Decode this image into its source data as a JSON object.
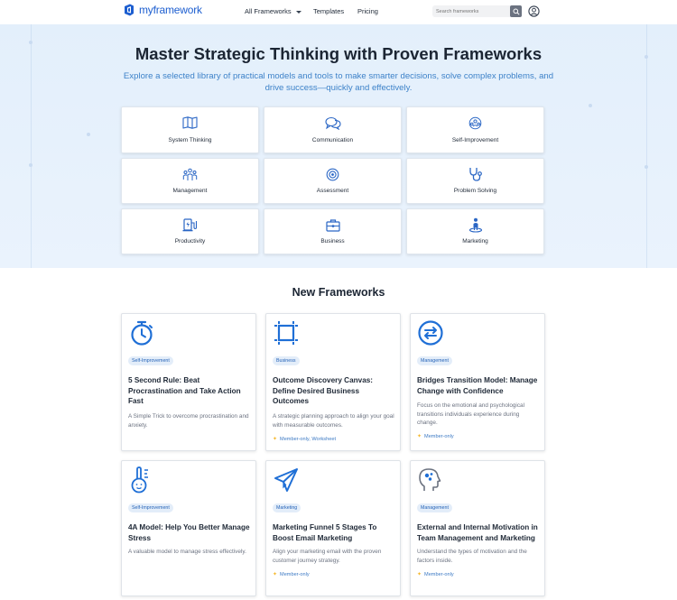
{
  "nav": {
    "logo_text": "myframework",
    "links": [
      {
        "label": "All Frameworks",
        "has_dropdown": true
      },
      {
        "label": "Templates"
      },
      {
        "label": "Pricing"
      }
    ],
    "search_placeholder": "Search frameworks"
  },
  "hero": {
    "title": "Master Strategic Thinking with Proven Frameworks",
    "subtitle": "Explore a selected library of practical models and tools to make smarter decisions, solve complex problems, and drive success—quickly and effectively."
  },
  "categories": [
    {
      "label": "System Thinking",
      "icon": "map-icon"
    },
    {
      "label": "Communication",
      "icon": "chat-bubbles-icon"
    },
    {
      "label": "Self-Improvement",
      "icon": "people-circle-icon"
    },
    {
      "label": "Management",
      "icon": "team-icon"
    },
    {
      "label": "Assessment",
      "icon": "target-icon"
    },
    {
      "label": "Problem Solving",
      "icon": "stethoscope-icon"
    },
    {
      "label": "Productivity",
      "icon": "ev-charger-icon"
    },
    {
      "label": "Business",
      "icon": "briefcase-icon"
    },
    {
      "label": "Marketing",
      "icon": "person-pin-icon"
    }
  ],
  "new_frameworks": {
    "title": "New Frameworks",
    "cards": [
      {
        "badge": "Self-Improvement",
        "title": "5 Second Rule: Beat Procrastination and Take Action Fast",
        "desc": "A Simple Trick to overcome procrastination and anxiety.",
        "meta": "",
        "icon": "stopwatch-icon"
      },
      {
        "badge": "Business",
        "title": "Outcome Discovery Canvas: Define Desired Business Outcomes",
        "desc": "A strategic planning approach to align your goal with measurable outcomes.",
        "meta": "Member-only, Worksheet",
        "icon": "canvas-frame-icon"
      },
      {
        "badge": "Management",
        "title": "Bridges Transition Model: Manage Change with Confidence",
        "desc": "Focus on the emotional and psychological transitions individuals experience during change.",
        "meta": "Member-only",
        "icon": "transition-arrows-icon"
      },
      {
        "badge": "Self-Improvement",
        "title": "4A Model: Help You Better Manage Stress",
        "desc": "A valuable model to manage stress effectively.",
        "meta": "",
        "icon": "thermometer-face-icon"
      },
      {
        "badge": "Marketing",
        "title": "Marketing Funnel 5 Stages To Boost Email Marketing",
        "desc": "Align your marketing email with the proven customer journey strategy.",
        "meta": "Member-only",
        "icon": "paper-plane-icon"
      },
      {
        "badge": "Management",
        "title": "External and Internal Motivation in Team Management and Marketing",
        "desc": "Understand the types of motivation and the factors inside.",
        "meta": "Member-only",
        "icon": "head-gears-icon"
      }
    ]
  },
  "colors": {
    "brand": "#1e5fd0",
    "accent_text": "#3d82c9",
    "hero_bg": "#e3effb",
    "badge_bg": "#e3edf9",
    "star": "#f5b82e"
  }
}
